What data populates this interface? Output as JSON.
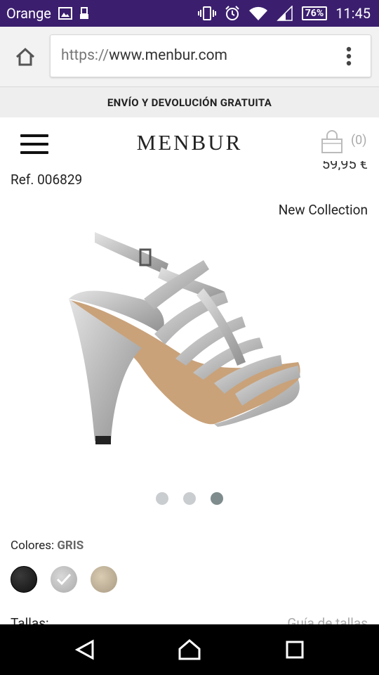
{
  "status_bar": {
    "carrier": "Orange",
    "battery": "76%",
    "time": "11:45"
  },
  "browser": {
    "url_scheme": "https://",
    "url_host": "www.menbur.com"
  },
  "promo": {
    "text": "ENVÍO Y DEVOLUCIÓN GRATUITA"
  },
  "header": {
    "logo": "MENBUR",
    "cart_count": "(0)"
  },
  "product": {
    "price_partial": "59,95 €",
    "ref": "Ref. 006829",
    "badge": "New Collection",
    "carousel": {
      "total": 3,
      "active": 3
    },
    "colors_label": "Colores:",
    "selected_color": "GRIS",
    "swatches": [
      "black",
      "grey",
      "gold"
    ],
    "sizes_label": "Tallas:",
    "size_guide": "Guía de tallas"
  },
  "colors": {
    "status_bar_bg": "#3b1f6e",
    "dot_active": "#7f8c8d",
    "dot_inactive": "#c9cdd0"
  }
}
